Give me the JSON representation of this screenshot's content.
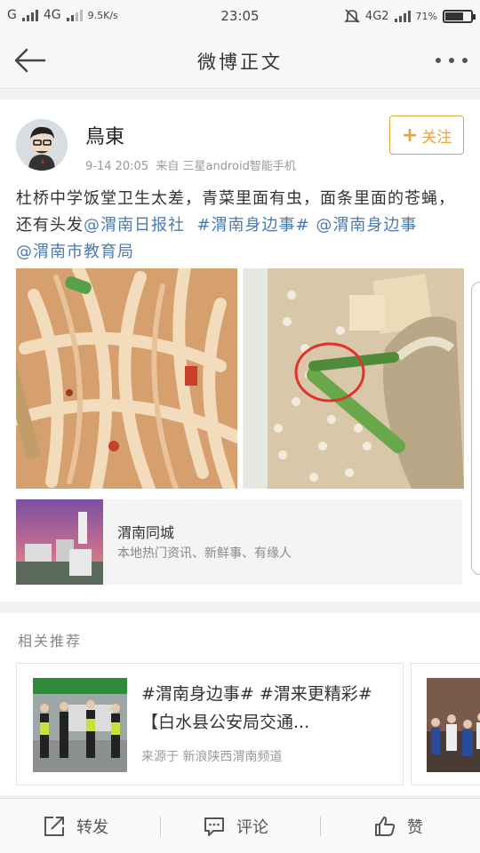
{
  "status_bar": {
    "carrier1": "G",
    "carrier2": "4G",
    "speed": "9.5K/s",
    "time": "23:05",
    "network": "4G2",
    "battery_text": "71%",
    "battery_level": 0.71
  },
  "nav": {
    "title": "微博正文"
  },
  "post": {
    "author": "鳥東",
    "time": "9-14 20:05",
    "source": "来自 三星android智能手机",
    "follow_label": "关注",
    "text_plain": "杜桥中学饭堂卫生太差，青菜里面有虫，面条里面的苍蝇，还有头发",
    "mention_1": "@渭南日报社",
    "topic_1": "#渭南身边事#",
    "mention_2": "@渭南身边事",
    "mention_3": "@渭南市教育局"
  },
  "link_card": {
    "title": "渭南同城",
    "subtitle": "本地热门资讯、新鲜事、有缘人"
  },
  "recommendations": {
    "header": "相关推荐",
    "items": [
      {
        "title": "#渭南身边事# #渭来更精彩# 【白水县公安局交通...",
        "source": "来源于 新浪陕西渭南频道"
      }
    ]
  },
  "bottom_bar": {
    "repost": "转发",
    "comment": "评论",
    "like": "赞"
  },
  "colors": {
    "accent": "#e8a33c",
    "link": "#4a7bb0"
  },
  "icons": [
    "back-arrow-icon",
    "more-icon",
    "follow-plus-icon",
    "repost-icon",
    "comment-icon",
    "like-icon"
  ]
}
